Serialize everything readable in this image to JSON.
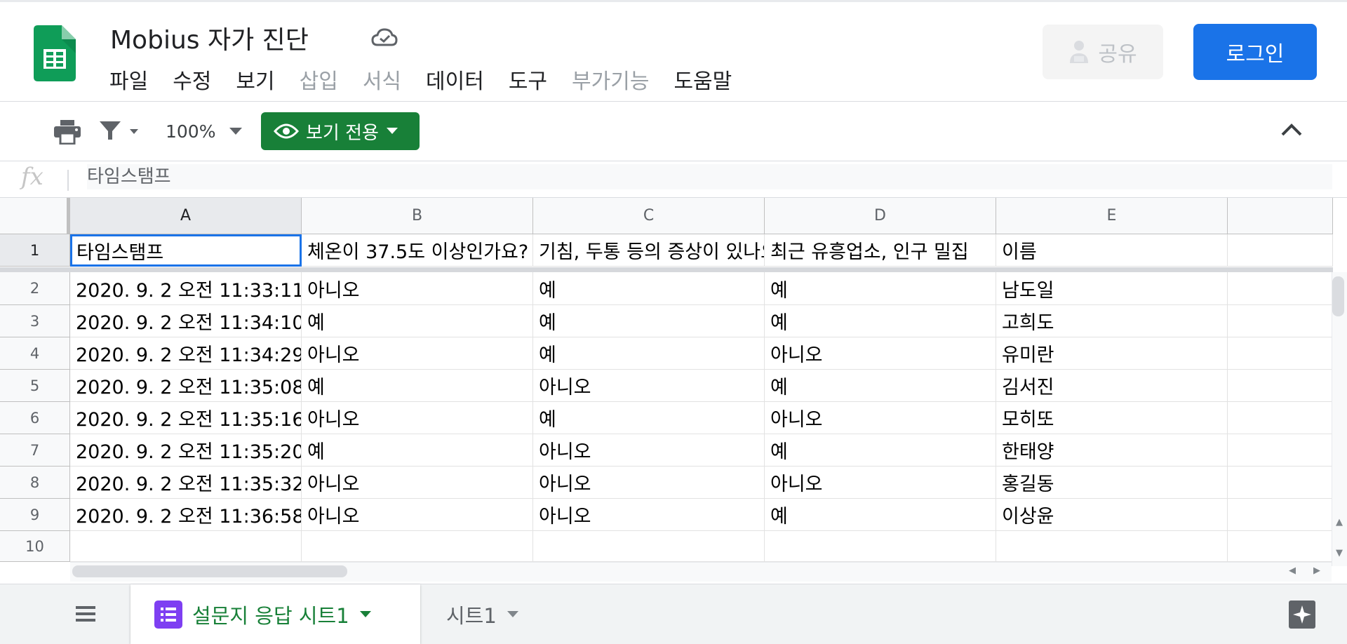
{
  "header": {
    "title": "Mobius 자가 진단",
    "menu": [
      {
        "label": "파일",
        "enabled": true
      },
      {
        "label": "수정",
        "enabled": true
      },
      {
        "label": "보기",
        "enabled": true
      },
      {
        "label": "삽입",
        "enabled": false
      },
      {
        "label": "서식",
        "enabled": false
      },
      {
        "label": "데이터",
        "enabled": true
      },
      {
        "label": "도구",
        "enabled": true
      },
      {
        "label": "부가기능",
        "enabled": false
      },
      {
        "label": "도움말",
        "enabled": true
      }
    ],
    "share_label": "공유",
    "login_label": "로그인"
  },
  "toolbar": {
    "zoom": "100%",
    "view_only_label": "보기 전용"
  },
  "formula_bar": {
    "fx": "fx",
    "value": "타임스탬프"
  },
  "grid": {
    "columns": [
      "A",
      "B",
      "C",
      "D",
      "E"
    ],
    "row_numbers": [
      "1",
      "2",
      "3",
      "4",
      "5",
      "6",
      "7",
      "8",
      "9",
      "10"
    ],
    "rows": [
      [
        "타임스탬프",
        "체온이 37.5도 이상인가요?",
        "기침, 두통 등의 증상이 있나요?",
        "최근 유흥업소, 인구 밀집",
        "이름"
      ],
      [
        "2020. 9. 2 오전 11:33:11",
        "아니오",
        "예",
        "예",
        "남도일"
      ],
      [
        "2020. 9. 2 오전 11:34:10",
        "예",
        "예",
        "예",
        "고희도"
      ],
      [
        "2020. 9. 2 오전 11:34:29",
        "아니오",
        "예",
        "아니오",
        "유미란"
      ],
      [
        "2020. 9. 2 오전 11:35:08",
        "예",
        "아니오",
        "예",
        "김서진"
      ],
      [
        "2020. 9. 2 오전 11:35:16",
        "아니오",
        "예",
        "아니오",
        "모히또"
      ],
      [
        "2020. 9. 2 오전 11:35:20",
        "예",
        "아니오",
        "예",
        "한태양"
      ],
      [
        "2020. 9. 2 오전 11:35:32",
        "아니오",
        "아니오",
        "아니오",
        "홍길동"
      ],
      [
        "2020. 9. 2 오전 11:36:58",
        "아니오",
        "아니오",
        "예",
        "이상윤"
      ],
      [
        "",
        "",
        "",
        "",
        ""
      ]
    ],
    "selected_cell": "A1"
  },
  "sheets": {
    "active": "설문지 응답 시트1",
    "other": "시트1"
  },
  "colors": {
    "accent_green": "#188038",
    "login_blue": "#1a73e8",
    "selection_blue": "#1a73e8"
  },
  "icons": [
    "sheets-logo-icon",
    "cloud-saved-icon",
    "print-icon",
    "filter-icon",
    "eye-icon",
    "chevron-up-icon",
    "all-sheets-menu-icon",
    "form-icon",
    "explore-icon",
    "person-icon"
  ]
}
